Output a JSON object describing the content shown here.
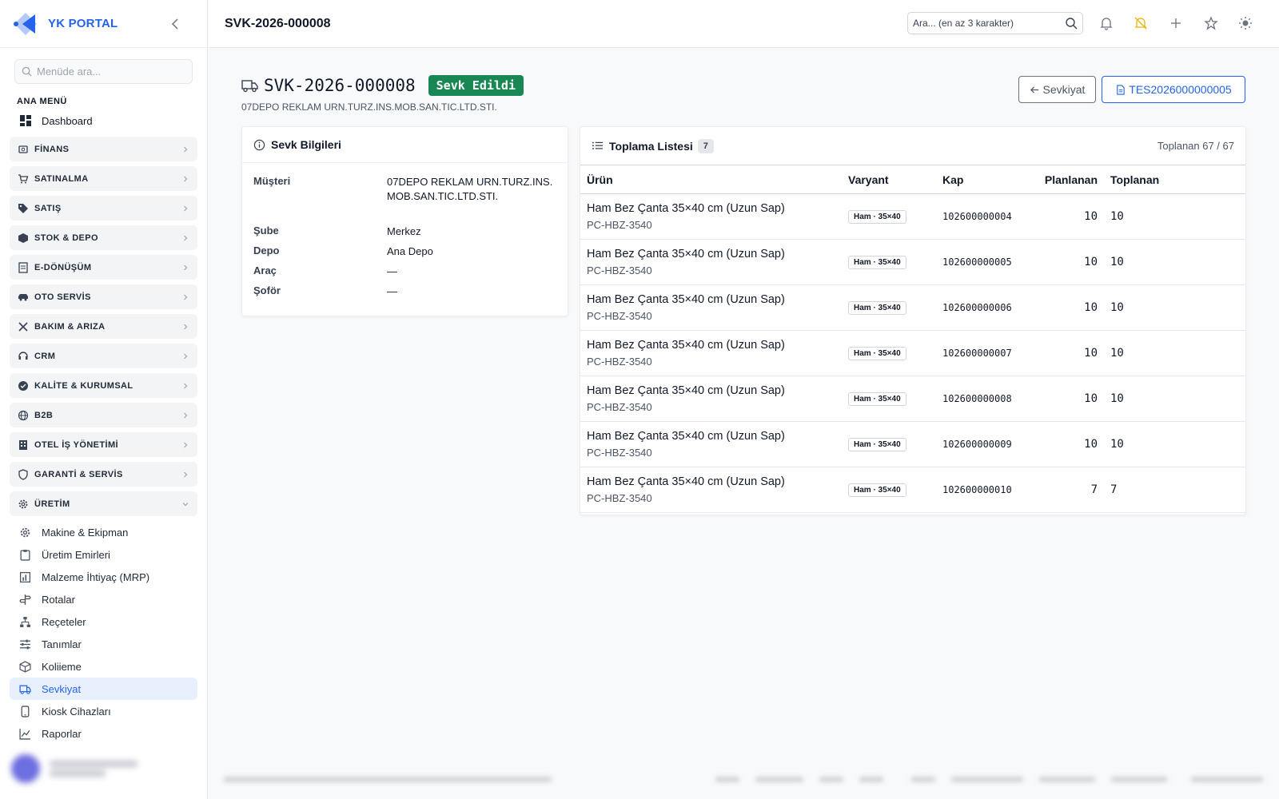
{
  "brand": {
    "name": "YK PORTAL"
  },
  "sidebar": {
    "search_placeholder": "Menüde ara...",
    "section_label": "ANA MENÜ",
    "dashboard_label": "Dashboard",
    "groups": [
      {
        "label": "FİNANS",
        "icon": "finance-icon"
      },
      {
        "label": "SATINALMA",
        "icon": "cart-icon"
      },
      {
        "label": "SATIŞ",
        "icon": "tag-icon"
      },
      {
        "label": "STOK & DEPO",
        "icon": "box-icon"
      },
      {
        "label": "E-DÖNÜŞÜM",
        "icon": "document-icon"
      },
      {
        "label": "OTO SERVİS",
        "icon": "car-icon"
      },
      {
        "label": "BAKIM & ARIZA",
        "icon": "tools-icon"
      },
      {
        "label": "CRM",
        "icon": "headset-icon"
      },
      {
        "label": "KALİTE & KURUMSAL",
        "icon": "badge-check-icon"
      },
      {
        "label": "B2B",
        "icon": "globe-icon"
      },
      {
        "label": "OTEL İŞ YÖNETİMİ",
        "icon": "building-icon"
      },
      {
        "label": "GARANTİ & SERVİS",
        "icon": "shield-icon"
      },
      {
        "label": "ÜRETİM",
        "icon": "gear-icon"
      }
    ],
    "production_items": [
      {
        "label": "Makine & Ekipman",
        "icon": "gear-icon"
      },
      {
        "label": "Üretim Emirleri",
        "icon": "clipboard-icon"
      },
      {
        "label": "Malzeme İhtiyaç (MRP)",
        "icon": "chart-icon"
      },
      {
        "label": "Rotalar",
        "icon": "signpost-icon"
      },
      {
        "label": "Reçeteler",
        "icon": "hierarchy-icon"
      },
      {
        "label": "Tanımlar",
        "icon": "sliders-icon"
      },
      {
        "label": "Koliieme",
        "icon": "package-icon"
      },
      {
        "label": "Sevkiyat",
        "icon": "truck-icon",
        "active": true
      },
      {
        "label": "Kiosk Cihazları",
        "icon": "tablet-icon"
      },
      {
        "label": "Raporlar",
        "icon": "trend-icon"
      }
    ]
  },
  "topbar": {
    "title": "SVK-2026-000008",
    "search_placeholder": "Ara... (en az 3 karakter)"
  },
  "page": {
    "code": "SVK-2026-000008",
    "status": "Sevk Edildi",
    "status_color": "#198754",
    "customer_subtitle": "07DEPO REKLAM URN.TURZ.INS.MOB.SAN.TIC.LTD.STI.",
    "back_button": "Sevkiyat",
    "doc_button": "TES2026000000005"
  },
  "info": {
    "title": "Sevk Bilgileri",
    "rows": [
      {
        "key": "Müşteri",
        "value": "07DEPO REKLAM URN.TURZ.INS.MOB.SAN.TIC.LTD.STI."
      },
      {
        "key": "Şube",
        "value": "Merkez"
      },
      {
        "key": "Depo",
        "value": "Ana Depo"
      },
      {
        "key": "Araç",
        "value": "—"
      },
      {
        "key": "Şoför",
        "value": "—"
      }
    ]
  },
  "picking": {
    "title": "Toplama Listesi",
    "count": "7",
    "total_text": "Toplanan 67 / 67",
    "columns": [
      "Ürün",
      "Varyant",
      "Kap",
      "Planlanan",
      "Toplanan"
    ],
    "rows": [
      {
        "name": "Ham Bez Çanta 35×40 cm (Uzun Sap)",
        "sku": "PC-HBZ-3540",
        "variant": "Ham · 35×40",
        "kap": "102600000004",
        "planned": "10",
        "picked": "10"
      },
      {
        "name": "Ham Bez Çanta 35×40 cm (Uzun Sap)",
        "sku": "PC-HBZ-3540",
        "variant": "Ham · 35×40",
        "kap": "102600000005",
        "planned": "10",
        "picked": "10"
      },
      {
        "name": "Ham Bez Çanta 35×40 cm (Uzun Sap)",
        "sku": "PC-HBZ-3540",
        "variant": "Ham · 35×40",
        "kap": "102600000006",
        "planned": "10",
        "picked": "10"
      },
      {
        "name": "Ham Bez Çanta 35×40 cm (Uzun Sap)",
        "sku": "PC-HBZ-3540",
        "variant": "Ham · 35×40",
        "kap": "102600000007",
        "planned": "10",
        "picked": "10"
      },
      {
        "name": "Ham Bez Çanta 35×40 cm (Uzun Sap)",
        "sku": "PC-HBZ-3540",
        "variant": "Ham · 35×40",
        "kap": "102600000008",
        "planned": "10",
        "picked": "10"
      },
      {
        "name": "Ham Bez Çanta 35×40 cm (Uzun Sap)",
        "sku": "PC-HBZ-3540",
        "variant": "Ham · 35×40",
        "kap": "102600000009",
        "planned": "10",
        "picked": "10"
      },
      {
        "name": "Ham Bez Çanta 35×40 cm (Uzun Sap)",
        "sku": "PC-HBZ-3540",
        "variant": "Ham · 35×40",
        "kap": "102600000010",
        "planned": "7",
        "picked": "7"
      }
    ]
  }
}
